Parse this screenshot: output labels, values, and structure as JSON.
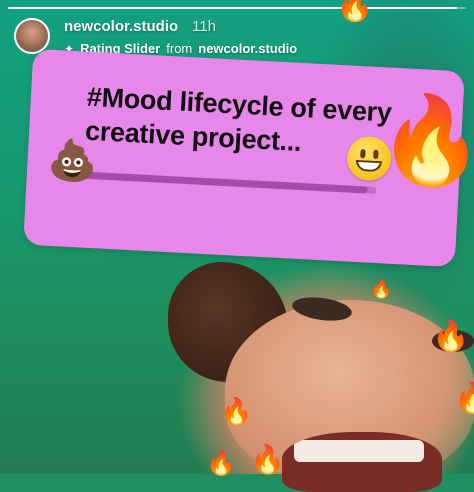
{
  "story": {
    "progress_fraction": 0.98
  },
  "header": {
    "username": "newcolor.studio",
    "timestamp": "11h",
    "sticker_icon": "sparkle-icon",
    "sticker_name": "Rating Slider",
    "from_word": "from",
    "source": "newcolor.studio"
  },
  "slider": {
    "question": "#Mood lifecycle of every creative project...",
    "start_emoji": "💩",
    "knob_emoji_face": "grinning-face-icon",
    "knob_emoji_flame": "🔥",
    "value_fraction": 0.97,
    "card_color": "#e787e9"
  },
  "background_flames": [
    "🔥",
    "🔥",
    "🔥",
    "🔥",
    "🔥",
    "🔥",
    "🔥"
  ]
}
